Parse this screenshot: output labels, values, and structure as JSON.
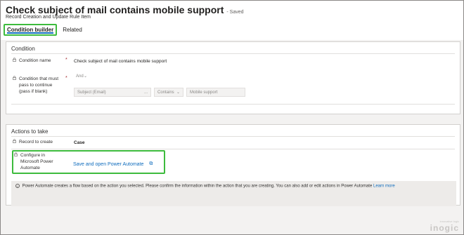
{
  "header": {
    "title": "Check subject of mail contains mobile support",
    "saved": "- Saved",
    "subtitle": "Record Creation and Update Rule Item"
  },
  "tabs": [
    {
      "label": "Condition builder",
      "active": true
    },
    {
      "label": "Related",
      "active": false
    }
  ],
  "condition": {
    "section_title": "Condition",
    "name_label": "Condition name",
    "name_required": "*",
    "name_value": "Check subject of mail contains mobile support",
    "pass_label_line1": "Condition that must",
    "pass_label_line2": "pass to continue",
    "pass_label_line3": "(pass if blank)",
    "pass_required": "*",
    "operator": "And",
    "field": "Subject (Email)",
    "field_more": "...",
    "comparison": "Contains",
    "compare_value": "Mobile support"
  },
  "actions": {
    "section_title": "Actions to take",
    "record_label": "Record to create",
    "record_value": "Case",
    "configure_label_line1": "Configure in",
    "configure_label_line2": "Microsoft Power",
    "configure_label_line3": "Automate",
    "configure_link": "Save and open Power Automate",
    "info_text": "Power Automate creates a flow based on the action you selected. Please confirm the information within the action that you are creating. You can also add or edit actions in Power Automate",
    "learn_more": "Learn more"
  },
  "watermark": {
    "tagline": "innovative logic",
    "brand": "inogic"
  },
  "colors": {
    "highlight_green": "#3dbb3d",
    "link_blue": "#0f6cbd",
    "required_red": "#a4262c"
  }
}
